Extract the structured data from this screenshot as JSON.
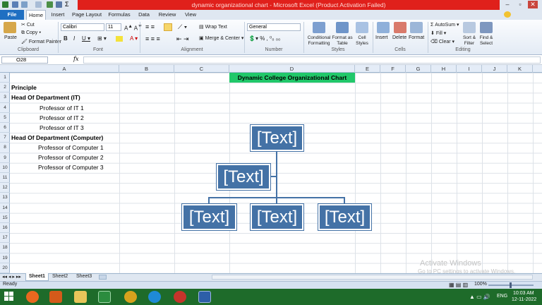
{
  "window": {
    "title": "dynamic organizational chart - Microsoft Excel (Product Activation Failed)"
  },
  "tabs": [
    "File",
    "Home",
    "Insert",
    "Page Layout",
    "Formulas",
    "Data",
    "Review",
    "View"
  ],
  "ribbon": {
    "clipboard": {
      "paste": "Paste",
      "cut": "Cut",
      "copy": "Copy",
      "format_painter": "Format Painter",
      "label": "Clipboard"
    },
    "font": {
      "name": "Calibri",
      "size": "11",
      "label": "Font"
    },
    "alignment": {
      "wrap": "Wrap Text",
      "merge": "Merge & Center",
      "label": "Alignment"
    },
    "number": {
      "format": "General",
      "label": "Number"
    },
    "styles": {
      "conditional": "Conditional Formatting",
      "format_table": "Format as Table",
      "cell_styles": "Cell Styles",
      "label": "Styles"
    },
    "cells": {
      "insert": "Insert",
      "delete": "Delete",
      "format": "Format",
      "label": "Cells"
    },
    "editing": {
      "autosum": "AutoSum",
      "fill": "Fill",
      "clear": "Clear",
      "sort": "Sort & Filter",
      "find": "Find & Select",
      "label": "Editing"
    }
  },
  "formula_bar": {
    "name_box": "O28",
    "fx": "fx",
    "value": ""
  },
  "columns": [
    "A",
    "B",
    "C",
    "D",
    "E",
    "F",
    "G",
    "H",
    "I",
    "J",
    "K"
  ],
  "rows": [
    "1",
    "2",
    "3",
    "4",
    "5",
    "6",
    "7",
    "8",
    "9",
    "10",
    "11",
    "12",
    "13",
    "14",
    "15",
    "16",
    "17",
    "18",
    "19",
    "20"
  ],
  "cells": {
    "D1": "Dynamic College Organizational Chart",
    "A2": "Principle",
    "A3": "Head Of Department (IT)",
    "A4": "Professor of IT 1",
    "A5": "Professor of IT 2",
    "A6": "Professor of IT 3",
    "A7": "Head Of Department (Computer)",
    "A8": "Professor of Computer 1",
    "A9": "Professor of Computer 2",
    "A10": "Professor of Computer 3"
  },
  "org_chart": {
    "top": "[Text]",
    "assistant": "[Text]",
    "children": [
      "[Text]",
      "[Text]",
      "[Text]"
    ]
  },
  "sheets": [
    "Sheet1",
    "Sheet2",
    "Sheet3"
  ],
  "status": {
    "ready": "Ready",
    "zoom": "100%"
  },
  "watermark": {
    "line1": "Activate Windows",
    "line2": "Go to PC settings to activate Windows."
  },
  "taskbar": {
    "lang": "ENG",
    "time": "10:03 AM",
    "date": "12-11-2022"
  },
  "colors": {
    "accent": "#21c86a",
    "smartart": "#4472a6",
    "file_tab": "#1f6fc2",
    "titlebar_red": "#e0201b"
  }
}
